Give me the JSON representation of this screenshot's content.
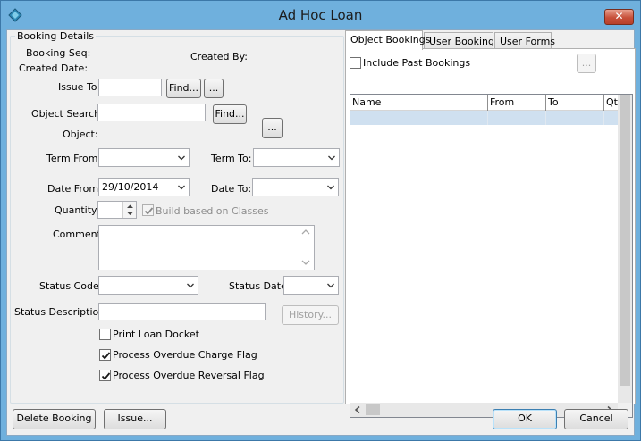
{
  "window": {
    "title": "Ad Hoc Loan",
    "close_glyph": "✕"
  },
  "booking": {
    "group_title": "Booking Details",
    "booking_seq_label": "Booking Seq:",
    "created_by_label": "Created By:",
    "created_date_label": "Created Date:",
    "issue_to_label": "Issue To",
    "issue_to_value": "",
    "find_label": "Find...",
    "ellipsis_label": "...",
    "object_search_label": "Object Search:",
    "object_search_value": "",
    "object_label": "Object:",
    "term_from_label": "Term From:",
    "term_from_value": "",
    "term_to_label": "Term To:",
    "term_to_value": "",
    "date_from_label": "Date From:",
    "date_from_value": "29/10/2014",
    "date_to_label": "Date To:",
    "date_to_value": "",
    "quantity_label": "Quantity:",
    "quantity_value": "",
    "build_classes_label": "Build based on Classes",
    "build_classes_checked": true,
    "comment_label": "Comment:",
    "comment_value": "",
    "status_code_label": "Status Code:",
    "status_code_value": "",
    "status_date_label": "Status Date:",
    "status_date_value": "",
    "status_description_label": "Status Description:",
    "status_description_value": "",
    "history_label": "History...",
    "print_docket_label": "Print Loan Docket",
    "print_docket_checked": false,
    "overdue_charge_label": "Process Overdue Charge Flag",
    "overdue_charge_checked": true,
    "overdue_reversal_label": "Process Overdue Reversal Flag",
    "overdue_reversal_checked": true
  },
  "tabs": [
    {
      "label": "Object Bookings",
      "active": true
    },
    {
      "label": "User Bookings",
      "active": false
    },
    {
      "label": "User Forms",
      "active": false
    }
  ],
  "object_bookings": {
    "include_past_label": "Include Past Bookings",
    "include_past_checked": false,
    "ellipsis_label": "...",
    "columns": [
      "Name",
      "From",
      "To",
      "Qty"
    ]
  },
  "footer": {
    "delete_label": "Delete Booking",
    "issue_label": "Issue...",
    "ok_label": "OK",
    "cancel_label": "Cancel"
  },
  "colors": {
    "titlebar": "#6fb0dd",
    "close": "#c7503a",
    "selection": "#cfe0f0"
  }
}
